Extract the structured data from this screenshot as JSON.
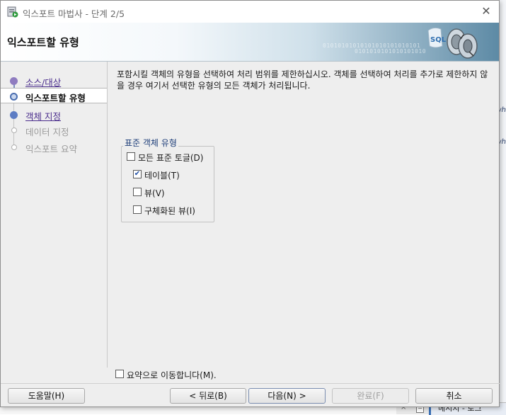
{
  "dialog": {
    "title": "익스포트 마법사 - 단계 2/5",
    "banner_title": "익스포트할 유형",
    "description": "포함시킬 객체의 유형을 선택하여 처리 범위를 제한하십시오. 객체를 선택하여 처리를 추가로 제한하지 않을 경우 여기서 선택한 유형의 모든 객체가 처리됩니다."
  },
  "steps": [
    {
      "label": "소스/대상",
      "state": "visited"
    },
    {
      "label": "익스포트할 유형",
      "state": "current"
    },
    {
      "label": "객체 지정",
      "state": "next"
    },
    {
      "label": "데이터 지정",
      "state": "disabled"
    },
    {
      "label": "익스포트 요약",
      "state": "disabled"
    }
  ],
  "object_types": {
    "legend": "표준 객체 유형",
    "options": [
      {
        "label": "모든 표준 토글(D)",
        "checked": false
      },
      {
        "label": "테이블(T)",
        "checked": true
      },
      {
        "label": "뷰(V)",
        "checked": false
      },
      {
        "label": "구체화된 뷰(I)",
        "checked": false
      }
    ]
  },
  "goto_summary": {
    "label": "요약으로 이동합니다(M).",
    "checked": false
  },
  "buttons": {
    "help": "도움말(H)",
    "back": "< 뒤로(B)",
    "next": "다음(N) >",
    "finish": "완료(F)",
    "cancel": "취소"
  },
  "background": {
    "fragment": "wh",
    "message_tab": "메시지 - 로그"
  },
  "icons": {
    "app": "export-wizard-icon",
    "close": "close-icon",
    "banner": "sql-export-graphic",
    "check": "checkmark-icon"
  },
  "colors": {
    "link": "#4a2d8c",
    "accent": "#4b6fb0",
    "banner_end": "#5d8aa5"
  }
}
